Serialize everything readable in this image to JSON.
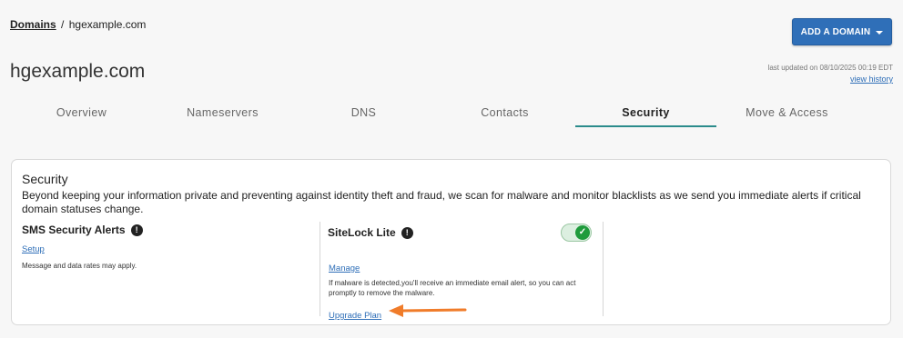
{
  "breadcrumb": {
    "root": "Domains",
    "separator": "/",
    "current": "hgexample.com"
  },
  "header": {
    "add_domain_label": "ADD A DOMAIN",
    "title": "hgexample.com",
    "last_updated": "last updated on 08/10/2025 00:19 EDT",
    "view_history": "view history"
  },
  "tabs": [
    {
      "label": "Overview"
    },
    {
      "label": "Nameservers"
    },
    {
      "label": "DNS"
    },
    {
      "label": "Contacts"
    },
    {
      "label": "Security"
    },
    {
      "label": "Move & Access"
    }
  ],
  "active_tab": "Security",
  "security": {
    "title": "Security",
    "description": "Beyond keeping your information private and preventing against identity theft and fraud, we scan for malware and monitor blacklists as we send you immediate alerts if critical domain statuses change.",
    "sms": {
      "title": "SMS Security Alerts",
      "setup_link": "Setup",
      "note": "Message and data rates may apply."
    },
    "sitelock": {
      "title": "SiteLock Lite",
      "toggle_on": true,
      "manage_link": "Manage",
      "note": "If malware is detected,you'll receive an immediate email alert, so you can act promptly to remove the malware.",
      "upgrade_link": "Upgrade Plan"
    }
  },
  "icons": {
    "info": "exclamation-circle-icon",
    "toggle_check": "checkmark-icon",
    "caret": "caret-down-icon",
    "annotation": "arrow-left-icon"
  },
  "colors": {
    "primary_button": "#2f6fb8",
    "active_tab_underline": "#2b8c8c",
    "toggle_on": "#1f9b3c",
    "annotation_arrow": "#f07c2a",
    "link": "#2f6fb8"
  }
}
